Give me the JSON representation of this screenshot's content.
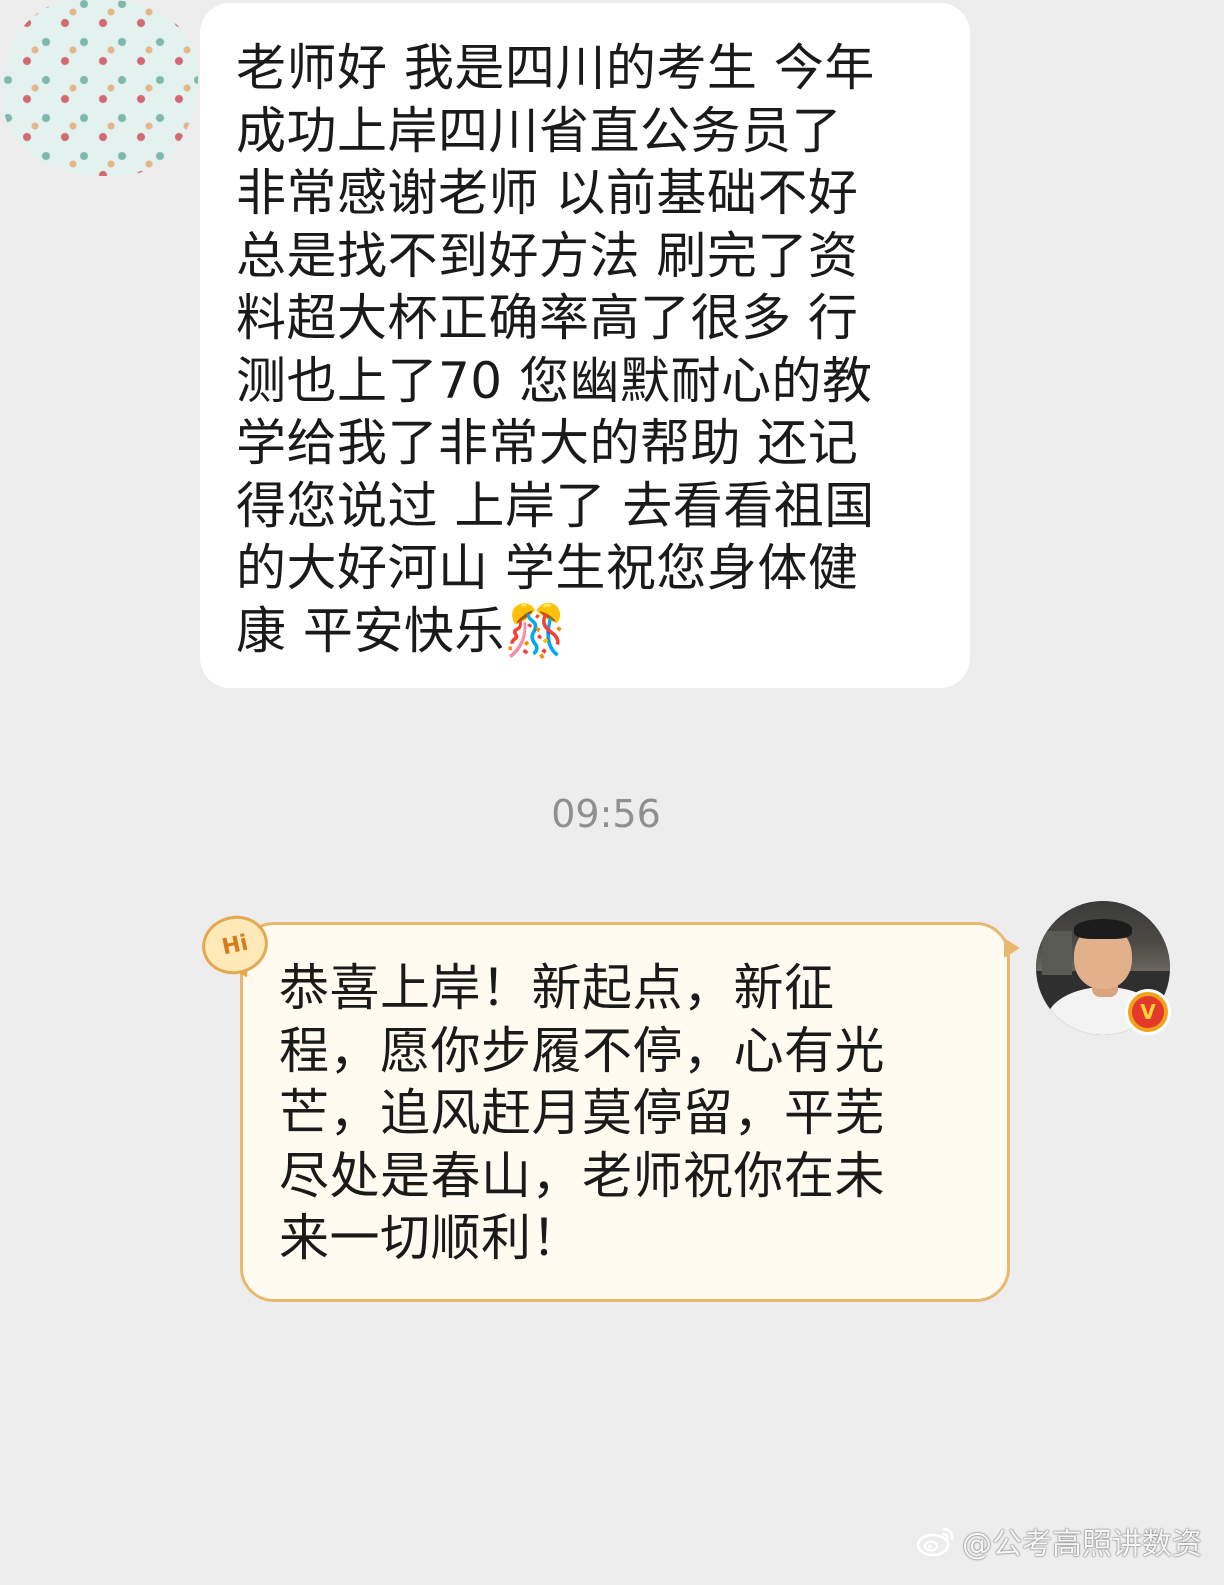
{
  "chat": {
    "incoming_message": "老师好 我是四川的考生 今年\n成功上岸四川省直公务员了\n非常感谢老师 以前基础不好\n总是找不到好方法 刷完了资\n料超大杯正确率高了很多 行\n测也上了70 您幽默耐心的教\n学给我了非常大的帮助 还记\n得您说过 上岸了 去看看祖国\n的大好河山 学生祝您身体健\n康 平安快乐🎊",
    "timestamp": "09:56",
    "outgoing_message": "恭喜上岸！新起点，新征\n程，愿你步履不停，心有光\n芒，追风赶月莫停留，平芜\n尽处是春山，老师祝你在未\n来一切顺利！",
    "hi_badge": "Hi",
    "verified_mark": "V"
  },
  "watermark": {
    "text": "@公考高照讲数资",
    "icon": "weibo-icon"
  },
  "colors": {
    "background": "#ededed",
    "incoming_bubble": "#ffffff",
    "outgoing_bubble": "#fffbf0",
    "outgoing_border": "#e8b86d",
    "timestamp": "#8f8f8f",
    "verified_badge": "#f0a21c"
  }
}
